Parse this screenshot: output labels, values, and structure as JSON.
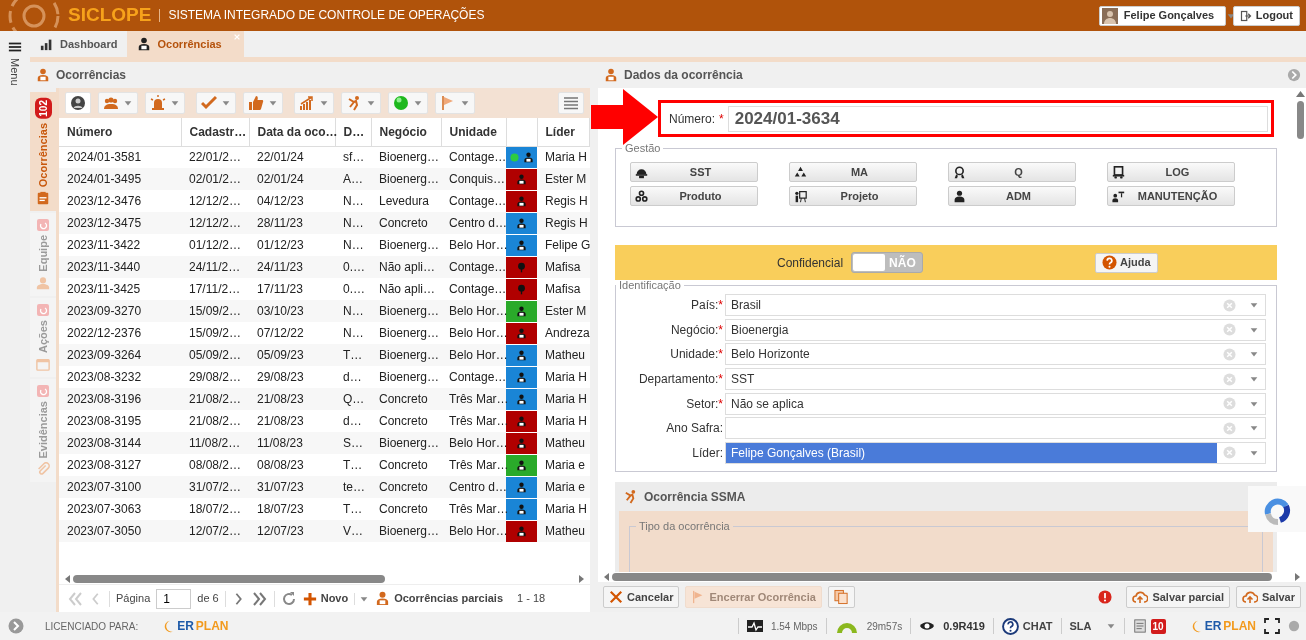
{
  "header": {
    "logo": "SICLOPE",
    "system_name": "SISTEMA INTEGRADO DE CONTROLE DE OPERAÇÕES",
    "user": "Felipe Gonçalves",
    "logout": "Logout"
  },
  "side_menu": {
    "label": "Menu"
  },
  "tabs": [
    {
      "label": "Dashboard",
      "selected": false
    },
    {
      "label": "Ocorrências",
      "selected": true
    }
  ],
  "list_panel": {
    "title": "Ocorrências",
    "side_tabs": [
      {
        "label": "Ocorrências",
        "badge": "102",
        "selected": true
      },
      {
        "label": "Equipe",
        "selected": false
      },
      {
        "label": "Ações",
        "selected": false
      },
      {
        "label": "Evidências",
        "selected": false
      }
    ],
    "table": {
      "columns": [
        {
          "kind": "text",
          "label": "Número"
        },
        {
          "kind": "text",
          "label": "Cadastr…"
        },
        {
          "kind": "text",
          "label": "Data da oco…"
        },
        {
          "kind": "text",
          "label": "D…"
        },
        {
          "kind": "text",
          "label": "Negócio"
        },
        {
          "kind": "text",
          "label": "Unidade"
        },
        {
          "kind": "status"
        },
        {
          "kind": "text",
          "label": "Líder"
        }
      ],
      "rows": [
        {
          "cells": [
            "2024/01-3581",
            "22/01/2…",
            "22/01/24",
            "sf…",
            "Bioenerg…",
            "Contage…",
            "Maria H"
          ],
          "color": "#1a85d6",
          "kind": "person",
          "dot": true
        },
        {
          "cells": [
            "2024/01-3495",
            "02/01/2…",
            "02/01/24",
            "A…",
            "Bioenerg…",
            "Conquis…",
            "Ester M"
          ],
          "color": "#b00000",
          "kind": "person",
          "dot": false
        },
        {
          "cells": [
            "2023/12-3476",
            "12/12/2…",
            "04/12/23",
            "N…",
            "Levedura",
            "Contage…",
            "Regis H"
          ],
          "color": "#b00000",
          "kind": "person",
          "dot": false
        },
        {
          "cells": [
            "2023/12-3475",
            "12/12/2…",
            "28/11/23",
            "N…",
            "Concreto",
            "Centro d…",
            "Regis H"
          ],
          "color": "#1a85d6",
          "kind": "person",
          "dot": false
        },
        {
          "cells": [
            "2023/11-3422",
            "01/12/2…",
            "01/12/23",
            "N…",
            "Bioenerg…",
            "Belo Hor…",
            "Felipe G"
          ],
          "color": "#1a85d6",
          "kind": "person",
          "dot": false
        },
        {
          "cells": [
            "2023/11-3440",
            "24/11/2…",
            "24/11/23",
            "0.…",
            "Não apli…",
            "Contage…",
            "Mafisa"
          ],
          "color": "#b00000",
          "kind": "tree",
          "dot": false
        },
        {
          "cells": [
            "2023/11-3425",
            "17/11/2…",
            "17/11/23",
            "0.…",
            "Não apli…",
            "Contage…",
            "Mafisa"
          ],
          "color": "#b00000",
          "kind": "tree",
          "dot": false
        },
        {
          "cells": [
            "2023/09-3270",
            "15/09/2…",
            "03/10/23",
            "N…",
            "Bioenerg…",
            "Belo Hor…",
            "Ester M"
          ],
          "color": "#2aaa2a",
          "kind": "person",
          "dot": false
        },
        {
          "cells": [
            "2022/12-2376",
            "15/09/2…",
            "07/12/22",
            "N…",
            "Bioenerg…",
            "Belo Hor…",
            "Andreza"
          ],
          "color": "#b00000",
          "kind": "person",
          "dot": false
        },
        {
          "cells": [
            "2023/09-3264",
            "05/09/2…",
            "05/09/23",
            "T…",
            "Bioenerg…",
            "Belo Hor…",
            "Matheu"
          ],
          "color": "#1a85d6",
          "kind": "person",
          "dot": false
        },
        {
          "cells": [
            "2023/08-3232",
            "29/08/2…",
            "29/08/23",
            "d…",
            "Bioenerg…",
            "Contage…",
            "Maria H"
          ],
          "color": "#1a85d6",
          "kind": "person",
          "dot": false
        },
        {
          "cells": [
            "2023/08-3196",
            "21/08/2…",
            "21/08/23",
            "Q…",
            "Concreto",
            "Três Mar…",
            "Maria H"
          ],
          "color": "#1a85d6",
          "kind": "person",
          "dot": false
        },
        {
          "cells": [
            "2023/08-3195",
            "21/08/2…",
            "21/08/23",
            "d…",
            "Concreto",
            "Três Mar…",
            "Maria H"
          ],
          "color": "#b00000",
          "kind": "person",
          "dot": false
        },
        {
          "cells": [
            "2023/08-3144",
            "11/08/2…",
            "11/08/23",
            "S…",
            "Bioenerg…",
            "Belo Hor…",
            "Matheu"
          ],
          "color": "#b00000",
          "kind": "person",
          "dot": false
        },
        {
          "cells": [
            "2023/08-3127",
            "08/08/2…",
            "08/08/23",
            "T…",
            "Concreto",
            "Três Mar…",
            "Maria e"
          ],
          "color": "#2aaa2a",
          "kind": "person",
          "dot": false
        },
        {
          "cells": [
            "2023/07-3100",
            "31/07/2…",
            "31/07/23",
            "te…",
            "Concreto",
            "Centro d…",
            "Maria e"
          ],
          "color": "#1a85d6",
          "kind": "person",
          "dot": false
        },
        {
          "cells": [
            "2023/07-3063",
            "18/07/2…",
            "18/07/23",
            "T…",
            "Concreto",
            "Três Mar…",
            "Maria H"
          ],
          "color": "#1a85d6",
          "kind": "person",
          "dot": false
        },
        {
          "cells": [
            "2023/07-3050",
            "12/07/2…",
            "12/07/23",
            "V…",
            "Bioenerg…",
            "Belo Hor…",
            "Matheu"
          ],
          "color": "#b00000",
          "kind": "person",
          "dot": false
        }
      ]
    },
    "pager": {
      "page_label": "Página",
      "page": "1",
      "of": "de 6",
      "new": "Novo",
      "partial": "Ocorrências parciais",
      "range": "1 - 18"
    }
  },
  "detail_panel": {
    "title": "Dados da ocorrência",
    "number_label": "Número:",
    "number_mark": "*",
    "number": "2024/01-3634",
    "gestao": {
      "legend": "Gestão",
      "buttons": [
        {
          "label": "SST",
          "kind": "helmet"
        },
        {
          "label": "MA",
          "kind": "recycle"
        },
        {
          "label": "Q",
          "kind": "award"
        },
        {
          "label": "LOG",
          "kind": "truck"
        },
        {
          "label": "Produto",
          "kind": "gears"
        },
        {
          "label": "Projeto",
          "kind": "presenter"
        },
        {
          "label": "ADM",
          "kind": "user"
        },
        {
          "label": "MANUTENÇÃO",
          "kind": "worker"
        }
      ]
    },
    "confidential": {
      "label": "Confidencial",
      "on": false,
      "state_text": "NÃO",
      "help": "Ajuda"
    },
    "identificacao": {
      "legend": "Identificação",
      "fields": [
        {
          "label": "País:",
          "mark": "*",
          "value": "Brasil",
          "selected": false
        },
        {
          "label": "Negócio:",
          "mark": "*",
          "value": "Bioenergia",
          "selected": false
        },
        {
          "label": "Unidade:",
          "mark": "*",
          "value": "Belo Horizonte",
          "selected": false
        },
        {
          "label": "Departamento:",
          "mark": "*",
          "value": "SST",
          "selected": false
        },
        {
          "label": "Setor:",
          "mark": "*",
          "value": "Não se aplica",
          "selected": false
        },
        {
          "label": "Ano Safra:",
          "selected": false
        },
        {
          "label": "Líder:",
          "value": "Felipe Gonçalves (Brasil)",
          "selected": true
        }
      ]
    },
    "ssma": {
      "title": "Ocorrência SSMA",
      "type_legend": "Tipo da ocorrência"
    },
    "actions": {
      "cancel": "Cancelar",
      "close": {
        "label": "Encerrar Ocorrência",
        "disabled": true
      },
      "save_partial": "Salvar parcial",
      "save": "Salvar"
    }
  },
  "footer": {
    "licensed": "LICENCIADO PARA:",
    "logo": [
      "ER",
      "PLAN"
    ],
    "speed": "1.54 Mbps",
    "timer": "29m57s",
    "version": "0.9R419",
    "chat": "CHAT",
    "sla": "SLA",
    "notifications": "10",
    "logo_right": [
      "ER",
      "PLAN"
    ]
  }
}
